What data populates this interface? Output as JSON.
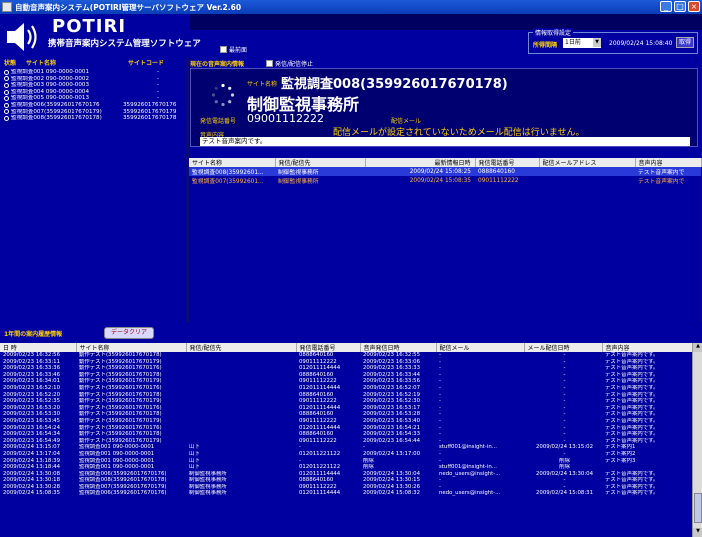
{
  "window": {
    "title": "自動音声案内システム(POTIRI管理サーバソフトウェア Ver.2.60"
  },
  "brand": {
    "name": "POTIRI",
    "subtitle": "携帯音声案内システム管理ソフトウェア"
  },
  "header": {
    "front_label": "最前面",
    "fetch": {
      "legend": "情報取得設定",
      "interval_label": "所得間隔",
      "interval_value": "1日前",
      "datetime": "2009/02/24 15:08:40",
      "button": "取得"
    }
  },
  "left": {
    "cols": {
      "status": "状態",
      "site": "サイト名称",
      "code": "サイトコード"
    },
    "sites": [
      {
        "name": "監視調査001 090-0000-0001",
        "code": "-"
      },
      {
        "name": "監視調査002 090-0000-0002",
        "code": "-"
      },
      {
        "name": "監視調査003 090-0000-0003",
        "code": "-"
      },
      {
        "name": "監視調査004 090-0000-0004",
        "code": "-"
      },
      {
        "name": "監視調査005 090-0000-0013",
        "code": "-"
      },
      {
        "name": "監視調査006(359926017670176",
        "code": "359926017670176"
      },
      {
        "name": "監視調査007(359926017670179)",
        "code": "359926017670179"
      },
      {
        "name": "監視調査008(359926017670178)",
        "code": "359926017670178"
      }
    ]
  },
  "current": {
    "header": "現在の音声案内情報",
    "stop_label": "発信/配信停止",
    "site_label": "サイト名称",
    "site_name": "監視調査008(359926017670178)",
    "site_big": "制御監視事務所",
    "phone_label": "発信電話番号",
    "phone_value": "09001112222",
    "mail_label": "配信メール",
    "mail_note": "配信メールが設定されていないためメール配信は行いません。",
    "voice_label": "音声内容",
    "voice_text": "テスト音声案内です。"
  },
  "upper_table": {
    "headers": [
      "サイト名称",
      "発信/配信先",
      "最新情報日時",
      "発信電話番号",
      "配信メールアドレス",
      "音声内容"
    ],
    "rows": [
      {
        "site": "監視調査008(35992601...",
        "dest": "制御監視事務所",
        "time": "2009/02/24 15:08:25",
        "phone": "0888640160",
        "mail": "",
        "voice": "テスト音声案内で",
        "style": "sel"
      },
      {
        "site": "監視調査007(35992601...",
        "dest": "制御監視事務所",
        "time": "2009/02/24 15:08:35",
        "phone": "09011112222",
        "mail": "",
        "voice": "テスト音声案内で",
        "style": "orange"
      }
    ]
  },
  "mid": {
    "history_label": "1年間の案内履歴情報",
    "clear_button": "データクリア"
  },
  "bottom_table": {
    "headers": [
      "日 時",
      "サイト名称",
      "発信/配信先",
      "発信電話番号",
      "音声発信日時",
      "配信メール",
      "メール配信日時",
      "音声内容"
    ],
    "rows": [
      [
        "2009/02/23 16:32:56",
        "動作テスト(359926017670178)",
        "",
        "0888640160",
        "2009/02/23 16:32:55",
        "-",
        "-",
        "テスト音声案内です。"
      ],
      [
        "2009/02/23 16:33:11",
        "動作テスト(359926017670179)",
        "",
        "09011112222",
        "2009/02/23 16:33:06",
        "-",
        "-",
        "テスト音声案内です。"
      ],
      [
        "2009/02/23 16:33:36",
        "動作テスト(359926017670176)",
        "",
        "012011114444",
        "2009/02/23 16:33:33",
        "-",
        "-",
        "テスト音声案内です。"
      ],
      [
        "2009/02/23 16:33:46",
        "動作テスト(359926017670178)",
        "",
        "0888640160",
        "2009/02/23 16:33:44",
        "-",
        "-",
        "テスト音声案内です。"
      ],
      [
        "2009/02/23 16:34:01",
        "動作テスト(359926017670179)",
        "",
        "09011112222",
        "2009/02/23 16:33:56",
        "-",
        "-",
        "テスト音声案内です。"
      ],
      [
        "2009/02/23 16:52:10",
        "動作テスト(359926017670176)",
        "",
        "012011114444",
        "2009/02/23 16:52:07",
        "-",
        "-",
        "テスト音声案内です。"
      ],
      [
        "2009/02/23 16:52:20",
        "動作テスト(359926017670178)",
        "",
        "0888640160",
        "2009/02/23 16:52:19",
        "-",
        "-",
        "テスト音声案内です。"
      ],
      [
        "2009/02/23 16:52:35",
        "動作テスト(359926017670179)",
        "",
        "09011112222",
        "2009/02/23 16:52:30",
        "-",
        "-",
        "テスト音声案内です。"
      ],
      [
        "2009/02/23 16:53:20",
        "動作テスト(359926017670176)",
        "",
        "012011114444",
        "2009/02/23 16:53:17",
        "-",
        "-",
        "テスト音声案内です。"
      ],
      [
        "2009/02/23 16:53:30",
        "動作テスト(359926017670178)",
        "",
        "0888640160",
        "2009/02/23 16:53:28",
        "-",
        "-",
        "テスト音声案内です。"
      ],
      [
        "2009/02/23 16:53:45",
        "動作テスト(359926017670179)",
        "",
        "09011112222",
        "2009/02/23 16:53:40",
        "-",
        "-",
        "テスト音声案内です。"
      ],
      [
        "2009/02/23 16:54:24",
        "動作テスト(359926017670176)",
        "",
        "012011114444",
        "2009/02/23 16:54:21",
        "-",
        "-",
        "テスト音声案内です。"
      ],
      [
        "2009/02/23 16:54:34",
        "動作テスト(359926017670178)",
        "",
        "0888640160",
        "2009/02/23 16:54:33",
        "-",
        "-",
        "テスト音声案内です。"
      ],
      [
        "2009/02/23 16:54:49",
        "動作テスト(359926017670179)",
        "",
        "09011112222",
        "2009/02/23 16:54:44",
        "-",
        "-",
        "テスト音声案内です。"
      ],
      [
        "2009/02/24 13:15:07",
        "監視調査001 090-0000-0001",
        "山下",
        "-",
        "-",
        "stuff001@insight-in...",
        "2009/02/24 13:15:02",
        "テスト案内1"
      ],
      [
        "2009/02/24 13:17:04",
        "監視調査001 090-0000-0001",
        "山下",
        "012011221122",
        "2009/02/24 13:17:00",
        "-",
        "-",
        "テスト案内2"
      ],
      [
        "2009/02/24 13:18:39",
        "監視調査001 090-0000-0001",
        "山下",
        "-",
        "削除",
        "-",
        "削除",
        "テスト案内3"
      ],
      [
        "2009/02/24 13:18:44",
        "監視調査001 090-0000-0001",
        "山下",
        "012011221122",
        "削除",
        "stuff001@insight-in...",
        "削除",
        ""
      ],
      [
        "2009/02/24 13:30:08",
        "監視調査006(359926017670176)",
        "制御監視事務所",
        "012011114444",
        "2009/02/24 13:30:04",
        "nedo_users@insight-...",
        "2009/02/24 13:30:04",
        "テスト音声案内です。"
      ],
      [
        "2009/02/24 13:30:18",
        "監視調査008(359926017670178)",
        "制御監視事務所",
        "0888640160",
        "2009/02/24 13:30:15",
        "-",
        "-",
        "テスト音声案内です。"
      ],
      [
        "2009/02/24 13:30:28",
        "監視調査007(359926017670179)",
        "制御監視事務所",
        "09011112222",
        "2009/02/24 13:30:26",
        "-",
        "-",
        "テスト音声案内です。"
      ],
      [
        "2009/02/24 15:08:35",
        "監視調査006(359926017670176)",
        "制御監視事務所",
        "012011114444",
        "2009/02/24 15:08:32",
        "nedo_users@insight-...",
        "2009/02/24 15:08:31",
        "テスト音声案内です。"
      ]
    ]
  }
}
